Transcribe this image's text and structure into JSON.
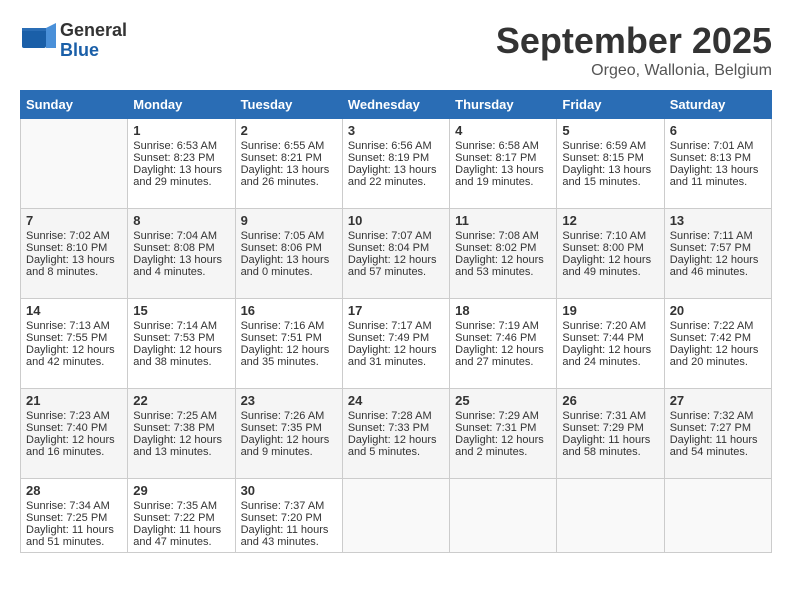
{
  "header": {
    "logo_general": "General",
    "logo_blue": "Blue",
    "month_title": "September 2025",
    "subtitle": "Orgeo, Wallonia, Belgium"
  },
  "weekdays": [
    "Sunday",
    "Monday",
    "Tuesday",
    "Wednesday",
    "Thursday",
    "Friday",
    "Saturday"
  ],
  "weeks": [
    [
      {
        "day": "",
        "info": ""
      },
      {
        "day": "1",
        "info": "Sunrise: 6:53 AM\nSunset: 8:23 PM\nDaylight: 13 hours\nand 29 minutes."
      },
      {
        "day": "2",
        "info": "Sunrise: 6:55 AM\nSunset: 8:21 PM\nDaylight: 13 hours\nand 26 minutes."
      },
      {
        "day": "3",
        "info": "Sunrise: 6:56 AM\nSunset: 8:19 PM\nDaylight: 13 hours\nand 22 minutes."
      },
      {
        "day": "4",
        "info": "Sunrise: 6:58 AM\nSunset: 8:17 PM\nDaylight: 13 hours\nand 19 minutes."
      },
      {
        "day": "5",
        "info": "Sunrise: 6:59 AM\nSunset: 8:15 PM\nDaylight: 13 hours\nand 15 minutes."
      },
      {
        "day": "6",
        "info": "Sunrise: 7:01 AM\nSunset: 8:13 PM\nDaylight: 13 hours\nand 11 minutes."
      }
    ],
    [
      {
        "day": "7",
        "info": "Sunrise: 7:02 AM\nSunset: 8:10 PM\nDaylight: 13 hours\nand 8 minutes."
      },
      {
        "day": "8",
        "info": "Sunrise: 7:04 AM\nSunset: 8:08 PM\nDaylight: 13 hours\nand 4 minutes."
      },
      {
        "day": "9",
        "info": "Sunrise: 7:05 AM\nSunset: 8:06 PM\nDaylight: 13 hours\nand 0 minutes."
      },
      {
        "day": "10",
        "info": "Sunrise: 7:07 AM\nSunset: 8:04 PM\nDaylight: 12 hours\nand 57 minutes."
      },
      {
        "day": "11",
        "info": "Sunrise: 7:08 AM\nSunset: 8:02 PM\nDaylight: 12 hours\nand 53 minutes."
      },
      {
        "day": "12",
        "info": "Sunrise: 7:10 AM\nSunset: 8:00 PM\nDaylight: 12 hours\nand 49 minutes."
      },
      {
        "day": "13",
        "info": "Sunrise: 7:11 AM\nSunset: 7:57 PM\nDaylight: 12 hours\nand 46 minutes."
      }
    ],
    [
      {
        "day": "14",
        "info": "Sunrise: 7:13 AM\nSunset: 7:55 PM\nDaylight: 12 hours\nand 42 minutes."
      },
      {
        "day": "15",
        "info": "Sunrise: 7:14 AM\nSunset: 7:53 PM\nDaylight: 12 hours\nand 38 minutes."
      },
      {
        "day": "16",
        "info": "Sunrise: 7:16 AM\nSunset: 7:51 PM\nDaylight: 12 hours\nand 35 minutes."
      },
      {
        "day": "17",
        "info": "Sunrise: 7:17 AM\nSunset: 7:49 PM\nDaylight: 12 hours\nand 31 minutes."
      },
      {
        "day": "18",
        "info": "Sunrise: 7:19 AM\nSunset: 7:46 PM\nDaylight: 12 hours\nand 27 minutes."
      },
      {
        "day": "19",
        "info": "Sunrise: 7:20 AM\nSunset: 7:44 PM\nDaylight: 12 hours\nand 24 minutes."
      },
      {
        "day": "20",
        "info": "Sunrise: 7:22 AM\nSunset: 7:42 PM\nDaylight: 12 hours\nand 20 minutes."
      }
    ],
    [
      {
        "day": "21",
        "info": "Sunrise: 7:23 AM\nSunset: 7:40 PM\nDaylight: 12 hours\nand 16 minutes."
      },
      {
        "day": "22",
        "info": "Sunrise: 7:25 AM\nSunset: 7:38 PM\nDaylight: 12 hours\nand 13 minutes."
      },
      {
        "day": "23",
        "info": "Sunrise: 7:26 AM\nSunset: 7:35 PM\nDaylight: 12 hours\nand 9 minutes."
      },
      {
        "day": "24",
        "info": "Sunrise: 7:28 AM\nSunset: 7:33 PM\nDaylight: 12 hours\nand 5 minutes."
      },
      {
        "day": "25",
        "info": "Sunrise: 7:29 AM\nSunset: 7:31 PM\nDaylight: 12 hours\nand 2 minutes."
      },
      {
        "day": "26",
        "info": "Sunrise: 7:31 AM\nSunset: 7:29 PM\nDaylight: 11 hours\nand 58 minutes."
      },
      {
        "day": "27",
        "info": "Sunrise: 7:32 AM\nSunset: 7:27 PM\nDaylight: 11 hours\nand 54 minutes."
      }
    ],
    [
      {
        "day": "28",
        "info": "Sunrise: 7:34 AM\nSunset: 7:25 PM\nDaylight: 11 hours\nand 51 minutes."
      },
      {
        "day": "29",
        "info": "Sunrise: 7:35 AM\nSunset: 7:22 PM\nDaylight: 11 hours\nand 47 minutes."
      },
      {
        "day": "30",
        "info": "Sunrise: 7:37 AM\nSunset: 7:20 PM\nDaylight: 11 hours\nand 43 minutes."
      },
      {
        "day": "",
        "info": ""
      },
      {
        "day": "",
        "info": ""
      },
      {
        "day": "",
        "info": ""
      },
      {
        "day": "",
        "info": ""
      }
    ]
  ]
}
